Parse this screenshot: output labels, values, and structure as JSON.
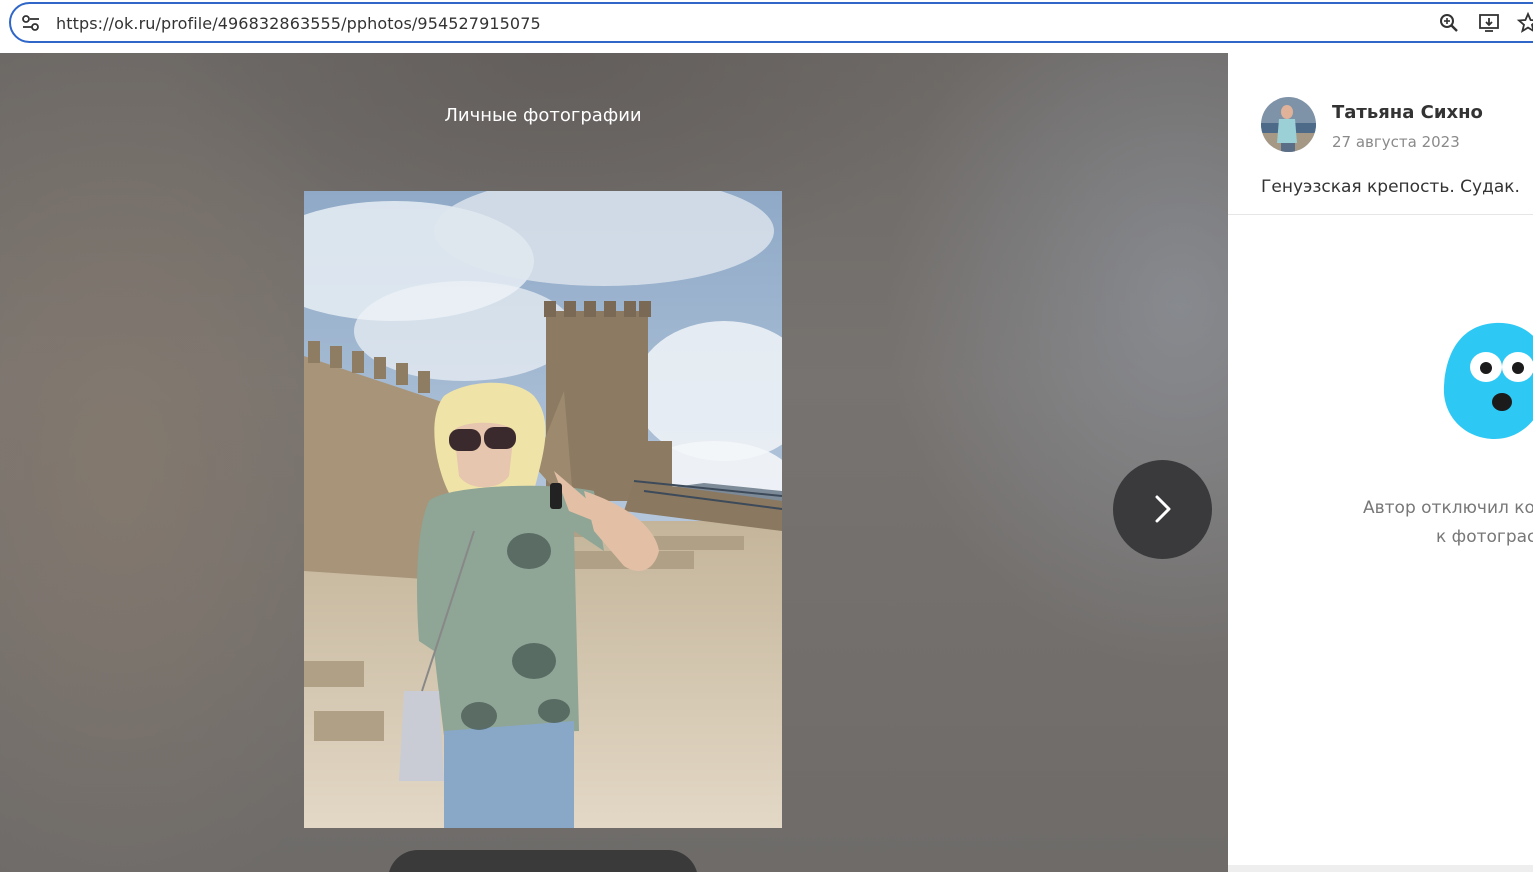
{
  "browser": {
    "url": "https://ok.ru/profile/496832863555/pphotos/954527915075",
    "icons": [
      "site-settings-icon",
      "zoom-icon",
      "install-app-icon",
      "bookmark-star-icon"
    ]
  },
  "viewer": {
    "album_title": "Личные фотографии",
    "next_icon": "chevron-right-icon"
  },
  "panel": {
    "author_name": "Татьяна Сихно",
    "date": "27 августа 2023",
    "description": "Генуэзская крепость. Судак.",
    "notice_line1": "Автор отключил ко",
    "notice_line2": "к фотограс"
  },
  "colors": {
    "accent": "#2f66c8",
    "mascot": "#2ec8f5"
  }
}
